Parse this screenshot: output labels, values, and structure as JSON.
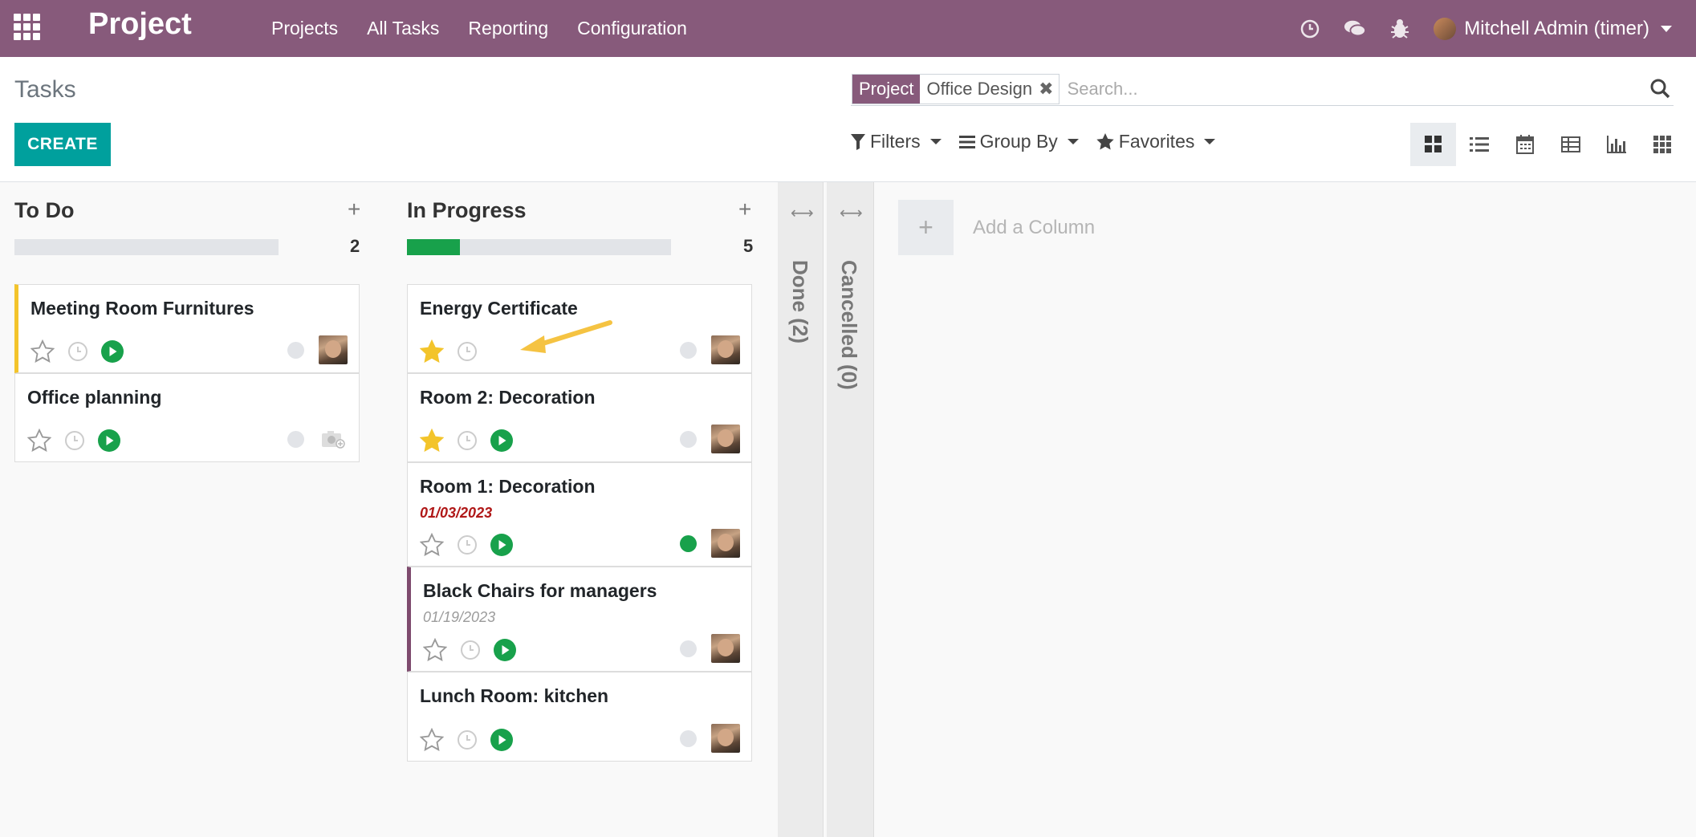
{
  "nav": {
    "brand": "Project",
    "menu": [
      "Projects",
      "All Tasks",
      "Reporting",
      "Configuration"
    ],
    "user": "Mitchell Admin (timer)"
  },
  "control": {
    "breadcrumb": "Tasks",
    "create_label": "CREATE",
    "facet_label": "Project",
    "facet_value": "Office Design",
    "search_placeholder": "Search...",
    "filters": "Filters",
    "group_by": "Group By",
    "favorites": "Favorites"
  },
  "columns": [
    {
      "title": "To Do",
      "count": "2",
      "progress": 0,
      "cards": [
        {
          "title": "Meeting Room Furnitures",
          "starred": false,
          "play": true,
          "stripe": "yellow",
          "status": "grey",
          "avatar": "photo"
        },
        {
          "title": "Office planning",
          "starred": false,
          "play": true,
          "stripe": "",
          "status": "grey",
          "avatar": "placeholder"
        }
      ]
    },
    {
      "title": "In Progress",
      "count": "5",
      "progress": 0.2,
      "cards": [
        {
          "title": "Energy Certificate",
          "starred": true,
          "play": false,
          "stripe": "",
          "status": "grey",
          "avatar": "photo"
        },
        {
          "title": "Room 2: Decoration",
          "starred": true,
          "play": true,
          "stripe": "",
          "status": "grey",
          "avatar": "photo"
        },
        {
          "title": "Room 1: Decoration",
          "date": "01/03/2023",
          "date_style": "overdue",
          "starred": false,
          "play": true,
          "stripe": "",
          "status": "green",
          "avatar": "photo"
        },
        {
          "title": "Black Chairs for managers",
          "date": "01/19/2023",
          "date_style": "normal",
          "starred": false,
          "play": true,
          "stripe": "purple",
          "status": "grey",
          "avatar": "photo"
        },
        {
          "title": "Lunch Room: kitchen",
          "starred": false,
          "play": true,
          "stripe": "",
          "status": "grey",
          "avatar": "photo"
        }
      ]
    }
  ],
  "folded": [
    {
      "label": "Done (2)"
    },
    {
      "label": "Cancelled (0)"
    }
  ],
  "add_column": "Add a Column",
  "colors": {
    "brand": "#875a7b",
    "create": "#00a09d",
    "success": "#18a14b",
    "star": "#f3c42b",
    "annotation": "#f5c342"
  }
}
